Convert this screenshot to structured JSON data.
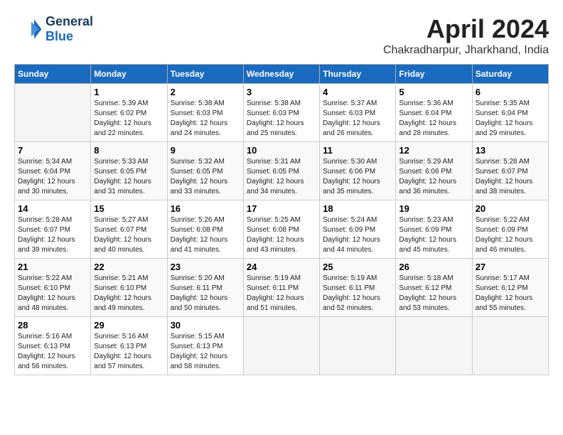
{
  "header": {
    "logo_general": "General",
    "logo_blue": "Blue",
    "month_title": "April 2024",
    "subtitle": "Chakradharpur, Jharkhand, India"
  },
  "days_of_week": [
    "Sunday",
    "Monday",
    "Tuesday",
    "Wednesday",
    "Thursday",
    "Friday",
    "Saturday"
  ],
  "weeks": [
    [
      {
        "day": "",
        "sunrise": "",
        "sunset": "",
        "daylight": ""
      },
      {
        "day": "1",
        "sunrise": "Sunrise: 5:39 AM",
        "sunset": "Sunset: 6:02 PM",
        "daylight": "Daylight: 12 hours and 22 minutes."
      },
      {
        "day": "2",
        "sunrise": "Sunrise: 5:38 AM",
        "sunset": "Sunset: 6:03 PM",
        "daylight": "Daylight: 12 hours and 24 minutes."
      },
      {
        "day": "3",
        "sunrise": "Sunrise: 5:38 AM",
        "sunset": "Sunset: 6:03 PM",
        "daylight": "Daylight: 12 hours and 25 minutes."
      },
      {
        "day": "4",
        "sunrise": "Sunrise: 5:37 AM",
        "sunset": "Sunset: 6:03 PM",
        "daylight": "Daylight: 12 hours and 26 minutes."
      },
      {
        "day": "5",
        "sunrise": "Sunrise: 5:36 AM",
        "sunset": "Sunset: 6:04 PM",
        "daylight": "Daylight: 12 hours and 28 minutes."
      },
      {
        "day": "6",
        "sunrise": "Sunrise: 5:35 AM",
        "sunset": "Sunset: 6:04 PM",
        "daylight": "Daylight: 12 hours and 29 minutes."
      }
    ],
    [
      {
        "day": "7",
        "sunrise": "Sunrise: 5:34 AM",
        "sunset": "Sunset: 6:04 PM",
        "daylight": "Daylight: 12 hours and 30 minutes."
      },
      {
        "day": "8",
        "sunrise": "Sunrise: 5:33 AM",
        "sunset": "Sunset: 6:05 PM",
        "daylight": "Daylight: 12 hours and 31 minutes."
      },
      {
        "day": "9",
        "sunrise": "Sunrise: 5:32 AM",
        "sunset": "Sunset: 6:05 PM",
        "daylight": "Daylight: 12 hours and 33 minutes."
      },
      {
        "day": "10",
        "sunrise": "Sunrise: 5:31 AM",
        "sunset": "Sunset: 6:05 PM",
        "daylight": "Daylight: 12 hours and 34 minutes."
      },
      {
        "day": "11",
        "sunrise": "Sunrise: 5:30 AM",
        "sunset": "Sunset: 6:06 PM",
        "daylight": "Daylight: 12 hours and 35 minutes."
      },
      {
        "day": "12",
        "sunrise": "Sunrise: 5:29 AM",
        "sunset": "Sunset: 6:06 PM",
        "daylight": "Daylight: 12 hours and 36 minutes."
      },
      {
        "day": "13",
        "sunrise": "Sunrise: 5:28 AM",
        "sunset": "Sunset: 6:07 PM",
        "daylight": "Daylight: 12 hours and 38 minutes."
      }
    ],
    [
      {
        "day": "14",
        "sunrise": "Sunrise: 5:28 AM",
        "sunset": "Sunset: 6:07 PM",
        "daylight": "Daylight: 12 hours and 39 minutes."
      },
      {
        "day": "15",
        "sunrise": "Sunrise: 5:27 AM",
        "sunset": "Sunset: 6:07 PM",
        "daylight": "Daylight: 12 hours and 40 minutes."
      },
      {
        "day": "16",
        "sunrise": "Sunrise: 5:26 AM",
        "sunset": "Sunset: 6:08 PM",
        "daylight": "Daylight: 12 hours and 41 minutes."
      },
      {
        "day": "17",
        "sunrise": "Sunrise: 5:25 AM",
        "sunset": "Sunset: 6:08 PM",
        "daylight": "Daylight: 12 hours and 43 minutes."
      },
      {
        "day": "18",
        "sunrise": "Sunrise: 5:24 AM",
        "sunset": "Sunset: 6:09 PM",
        "daylight": "Daylight: 12 hours and 44 minutes."
      },
      {
        "day": "19",
        "sunrise": "Sunrise: 5:23 AM",
        "sunset": "Sunset: 6:09 PM",
        "daylight": "Daylight: 12 hours and 45 minutes."
      },
      {
        "day": "20",
        "sunrise": "Sunrise: 5:22 AM",
        "sunset": "Sunset: 6:09 PM",
        "daylight": "Daylight: 12 hours and 46 minutes."
      }
    ],
    [
      {
        "day": "21",
        "sunrise": "Sunrise: 5:22 AM",
        "sunset": "Sunset: 6:10 PM",
        "daylight": "Daylight: 12 hours and 48 minutes."
      },
      {
        "day": "22",
        "sunrise": "Sunrise: 5:21 AM",
        "sunset": "Sunset: 6:10 PM",
        "daylight": "Daylight: 12 hours and 49 minutes."
      },
      {
        "day": "23",
        "sunrise": "Sunrise: 5:20 AM",
        "sunset": "Sunset: 6:11 PM",
        "daylight": "Daylight: 12 hours and 50 minutes."
      },
      {
        "day": "24",
        "sunrise": "Sunrise: 5:19 AM",
        "sunset": "Sunset: 6:11 PM",
        "daylight": "Daylight: 12 hours and 51 minutes."
      },
      {
        "day": "25",
        "sunrise": "Sunrise: 5:19 AM",
        "sunset": "Sunset: 6:11 PM",
        "daylight": "Daylight: 12 hours and 52 minutes."
      },
      {
        "day": "26",
        "sunrise": "Sunrise: 5:18 AM",
        "sunset": "Sunset: 6:12 PM",
        "daylight": "Daylight: 12 hours and 53 minutes."
      },
      {
        "day": "27",
        "sunrise": "Sunrise: 5:17 AM",
        "sunset": "Sunset: 6:12 PM",
        "daylight": "Daylight: 12 hours and 55 minutes."
      }
    ],
    [
      {
        "day": "28",
        "sunrise": "Sunrise: 5:16 AM",
        "sunset": "Sunset: 6:13 PM",
        "daylight": "Daylight: 12 hours and 56 minutes."
      },
      {
        "day": "29",
        "sunrise": "Sunrise: 5:16 AM",
        "sunset": "Sunset: 6:13 PM",
        "daylight": "Daylight: 12 hours and 57 minutes."
      },
      {
        "day": "30",
        "sunrise": "Sunrise: 5:15 AM",
        "sunset": "Sunset: 6:13 PM",
        "daylight": "Daylight: 12 hours and 58 minutes."
      },
      {
        "day": "",
        "sunrise": "",
        "sunset": "",
        "daylight": ""
      },
      {
        "day": "",
        "sunrise": "",
        "sunset": "",
        "daylight": ""
      },
      {
        "day": "",
        "sunrise": "",
        "sunset": "",
        "daylight": ""
      },
      {
        "day": "",
        "sunrise": "",
        "sunset": "",
        "daylight": ""
      }
    ]
  ]
}
